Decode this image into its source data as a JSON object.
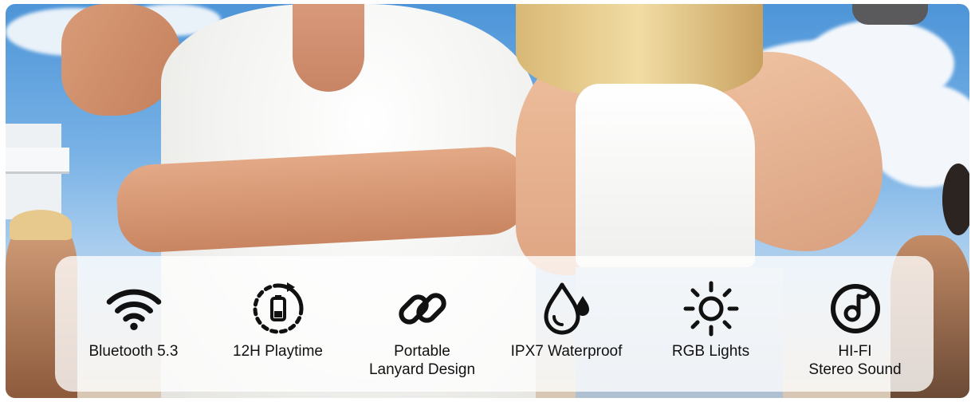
{
  "features": [
    {
      "label": "Bluetooth 5.3",
      "icon": "wifi-icon"
    },
    {
      "label": "12H Playtime",
      "icon": "battery-cycle-icon"
    },
    {
      "label": "Portable\nLanyard Design",
      "icon": "chain-link-icon"
    },
    {
      "label": "IPX7 Waterproof",
      "icon": "water-drop-icon"
    },
    {
      "label": "RGB Lights",
      "icon": "sun-icon"
    },
    {
      "label": "HI-FI\nStereo Sound",
      "icon": "music-disc-icon"
    }
  ],
  "colors": {
    "icon": "#111111",
    "panel": "#ffffff"
  }
}
